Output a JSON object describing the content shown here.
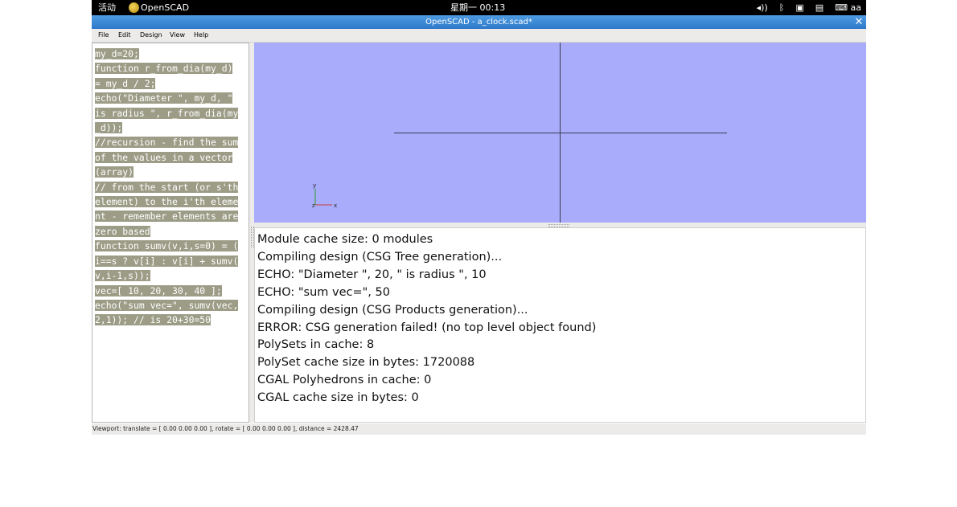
{
  "topbar": {
    "activities": "活动",
    "app_name": "OpenSCAD",
    "clock": "星期一 00:13",
    "tray": {
      "volume_icon": "volume-icon",
      "bluetooth_icon": "bluetooth-icon",
      "network_icon": "network-icon",
      "clipboard_icon": "clipboard-icon",
      "ime_label": "aa"
    }
  },
  "window": {
    "title": "OpenSCAD - a_clock.scad*"
  },
  "menubar": [
    "File",
    "Edit",
    "Design",
    "View",
    "Help"
  ],
  "editor": {
    "lines": [
      "my_d=20;",
      "function r_from_dia(my_d)",
      "= my_d / 2;",
      "echo(\"Diameter \", my_d, \"",
      "is radius \", r_from_dia(my",
      "_d));",
      "//recursion - find the sum",
      "of the values in a vector",
      "(array)",
      "// from the start (or s'th",
      "element) to the i'th eleme",
      "nt - remember elements are",
      "zero based",
      "function sumv(v,i,s=0) = (",
      "i==s ? v[i] : v[i] + sumv(",
      "v,i-1,s));",
      "vec=[ 10, 20, 30, 40 ];",
      "echo(\"sum vec=\", sumv(vec,",
      "2,1)); // is 20+30=50"
    ]
  },
  "viewport": {
    "background": "#a8acfb",
    "axis_labels": {
      "x": "x",
      "y": "y",
      "z": "z"
    }
  },
  "console": {
    "lines": [
      "Module cache size: 0 modules",
      "Compiling design (CSG Tree generation)...",
      "ECHO: \"Diameter \", 20, \" is radius \", 10",
      "ECHO: \"sum vec=\", 50",
      "Compiling design (CSG Products generation)...",
      "ERROR: CSG generation failed! (no top level object found)",
      "PolySets in cache: 8",
      "PolySet cache size in bytes: 1720088",
      "CGAL Polyhedrons in cache: 0",
      "CGAL cache size in bytes: 0"
    ]
  },
  "statusbar": {
    "text": "Viewport: translate = [ 0.00 0.00 0.00 ], rotate = [ 0.00 0.00 0.00 ], distance = 2428.47"
  },
  "colors": {
    "code_highlight": "#9c9c87",
    "titlebar": "#2d79c9",
    "viewport": "#a8acfb"
  }
}
